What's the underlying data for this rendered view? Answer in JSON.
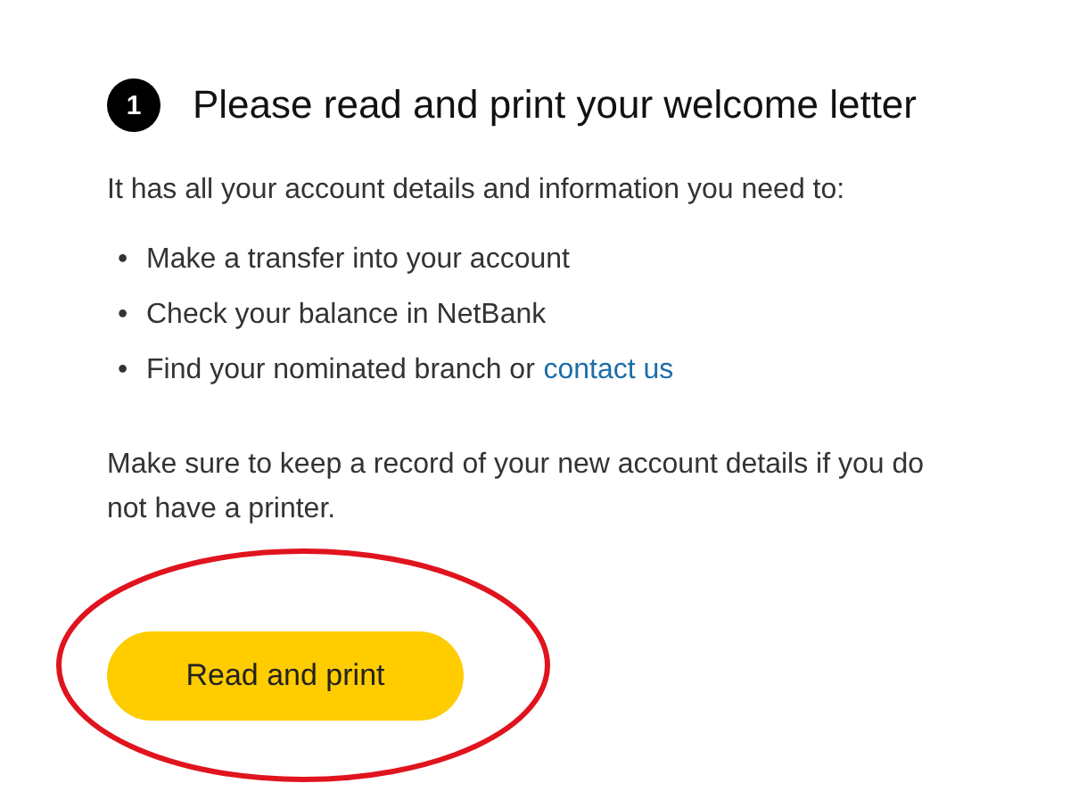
{
  "step": {
    "number": "1",
    "title": "Please read and print your welcome letter"
  },
  "intro": "It has all your account details and information you need to:",
  "bullets": [
    {
      "marker": "•",
      "text": "Make a transfer into your account"
    },
    {
      "marker": "•",
      "text": "Check your balance in NetBank"
    },
    {
      "marker": "•",
      "text": "Find your nominated branch or",
      "link": "contact us"
    }
  ],
  "note": "Make sure to keep a record of your new account details if you do not have a printer.",
  "button": {
    "label": "Read and print"
  },
  "annotation": {
    "kind": "ellipse"
  }
}
